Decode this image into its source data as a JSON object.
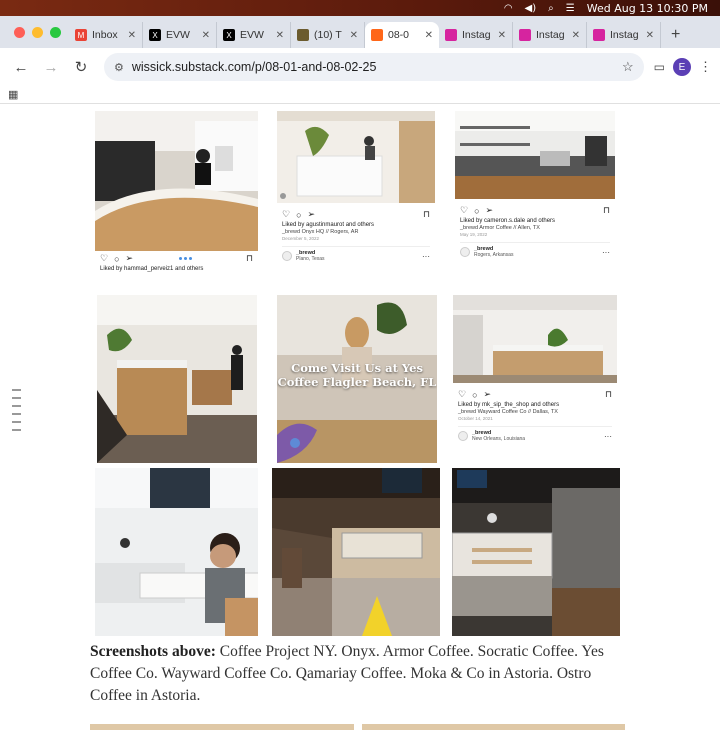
{
  "menubar": {
    "datetime": "Wed Aug 13  10:30 PM"
  },
  "tabs": [
    {
      "title": "Inbox",
      "icon": "gmail-icon",
      "color": "#ea4335",
      "glyph": "M"
    },
    {
      "title": "EVW",
      "icon": "x-icon",
      "color": "#000000",
      "glyph": "X"
    },
    {
      "title": "EVW",
      "icon": "x-icon",
      "color": "#000000",
      "glyph": "X"
    },
    {
      "title": "(10) T",
      "icon": "site-icon",
      "color": "#6b5b2e",
      "glyph": ""
    },
    {
      "title": "08-0",
      "icon": "substack-icon",
      "color": "#ff6719",
      "glyph": "",
      "active": true
    },
    {
      "title": "Instag",
      "icon": "instagram-icon",
      "color": "#d6249f",
      "glyph": ""
    },
    {
      "title": "Instag",
      "icon": "instagram-icon",
      "color": "#d6249f",
      "glyph": ""
    },
    {
      "title": "Instag",
      "icon": "instagram-icon",
      "color": "#d6249f",
      "glyph": ""
    }
  ],
  "toolbar": {
    "url": "wissick.substack.com/p/08-01-and-08-02-25",
    "avatar_letter": "E"
  },
  "posts": {
    "p1": {
      "liked": "Liked by hammad_perveiz1 and others"
    },
    "p2": {
      "liked": "Liked by agustinmaurot and others",
      "caption": "_brewd Onyx HQ // Rogers, AR",
      "date": "December 5, 2022",
      "profile": "_brewd",
      "location": "Plano, Texas"
    },
    "p3": {
      "liked": "Liked by cameron.s.dale and others",
      "caption": "_brewd Armor Coffee // Allen, TX",
      "date": "May 19, 2022",
      "profile": "_brewd",
      "location": "Rogers, Arkansas"
    },
    "p5": {
      "overlay": "Come Visit Us at Yes Coffee Flagler Beach, FL"
    },
    "p6": {
      "liked": "Liked by mk_sip_the_shop and others",
      "caption": "_brewd Wayward Coffee Co // Dallas, TX",
      "date": "October 14, 2021",
      "profile": "_brewd",
      "location": "New Orleans, Louisiana"
    }
  },
  "caption": {
    "lead": "Screenshots above:",
    "text": " Coffee Project NY. Onyx. Armor Coffee. Socratic Coffee. Yes Coffee Co. Wayward Coffee Co. Qamariay Coffee. Moka & Co in Astoria. Ostro Coffee in Astoria."
  }
}
